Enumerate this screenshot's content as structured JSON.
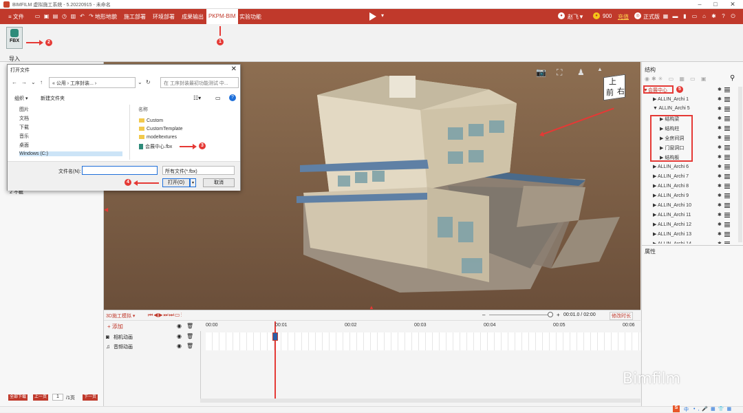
{
  "window": {
    "title": "BIMFILM 虚拟施工系统 - 5.20220915 - 未命名"
  },
  "menubar": {
    "file_label": "≡ 文件",
    "items": [
      {
        "label": "地形地貌"
      },
      {
        "label": "施工部署"
      },
      {
        "label": "环境部署"
      },
      {
        "label": "成果输出"
      },
      {
        "label": "PKPM-BIM"
      },
      {
        "label": "实验功能"
      }
    ],
    "user": "赵飞▼",
    "coins": "900",
    "recharge": "充值",
    "edition": "正式版"
  },
  "ribbon": {
    "fbx_label": "FBX",
    "import_label": "导入"
  },
  "annotations": {
    "a1": "1",
    "a2": "2",
    "a3": "3",
    "a4": "4",
    "a5": "5"
  },
  "dialog": {
    "title": "打开文件",
    "path": "« 公用 › 工序封装... ›",
    "search_placeholder": "在 工序封装最初功能测试 中...",
    "organize": "组织 ▾",
    "new_folder": "新建文件夹",
    "nav_items": [
      "图片",
      "文档",
      "下载",
      "音乐",
      "桌面",
      "Windows (C:)"
    ],
    "col_name": "名称",
    "files": [
      "Custom",
      "CustomTemplate",
      "modeltextures",
      "会展中心.fbx"
    ],
    "filename_label": "文件名(N):",
    "filetype": "所有文件(*.fbx)",
    "open": "打开(O)",
    "cancel": "取消"
  },
  "leftpanel": {
    "partial_label": "2 不截",
    "page_first": "全部下载",
    "page_prev": "上一页",
    "page_num": "1",
    "page_total": "/1页",
    "page_next": "下一页"
  },
  "viewcube": {
    "top": "上",
    "front": "前",
    "right": "右"
  },
  "rightpanel": {
    "title": "结构",
    "props_title": "属性",
    "tree": [
      {
        "label": "▼会展中心",
        "indent": 2,
        "hl": true
      },
      {
        "label": "▶ ALLIN_Archi 1",
        "indent": 16
      },
      {
        "label": "▼ ALLIN_Archi 5",
        "indent": 16
      },
      {
        "label": "▶ 结构梁",
        "indent": 26
      },
      {
        "label": "▶ 结构柱",
        "indent": 26
      },
      {
        "label": "▶ 全房间洞",
        "indent": 26
      },
      {
        "label": "▶ 门窗洞口",
        "indent": 26
      },
      {
        "label": "▶ 结构板",
        "indent": 26
      },
      {
        "label": "▶ ALLIN_Archi 6",
        "indent": 16
      },
      {
        "label": "▶ ALLIN_Archi 7",
        "indent": 16
      },
      {
        "label": "▶ ALLIN_Archi 8",
        "indent": 16
      },
      {
        "label": "▶ ALLIN_Archi 9",
        "indent": 16
      },
      {
        "label": "▶ ALLIN_Archi 10",
        "indent": 16
      },
      {
        "label": "▶ ALLIN_Archi 11",
        "indent": 16
      },
      {
        "label": "▶ ALLIN_Archi 12",
        "indent": 16
      },
      {
        "label": "▶ ALLIN_Archi 13",
        "indent": 16
      },
      {
        "label": "▶ ALLIN_Archi 14",
        "indent": 16
      }
    ]
  },
  "timeline": {
    "mode": "3D施工模拟 ▾",
    "add": "+ 添加",
    "time": "00:01.0 / 02:00",
    "edit_duration": "修改时长",
    "ticks": [
      "00:00",
      "00:01",
      "00:02",
      "00:03",
      "00:04",
      "00:05",
      "00:06"
    ],
    "tracks": [
      {
        "label": "相机动画"
      },
      {
        "label": "音频动画"
      }
    ],
    "playhead_fraction": 0.0083
  },
  "watermark": "Bimfilm",
  "statusbar": {
    "ime": "中"
  },
  "colors": {
    "brand": "#c0392b",
    "annotation": "#e53935"
  }
}
